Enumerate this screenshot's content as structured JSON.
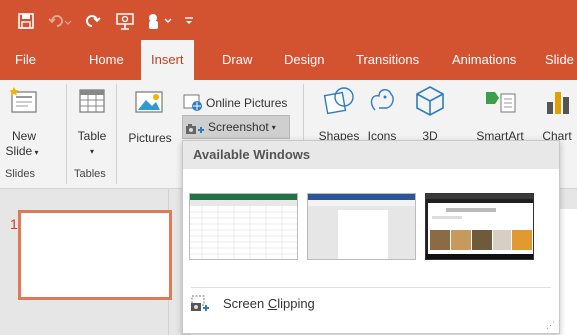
{
  "qat": {
    "save_icon": "save-icon",
    "undo_icon": "undo-icon",
    "redo_icon": "redo-icon",
    "from_beginning_icon": "presentation-icon",
    "touch_icon": "touch-mode-icon"
  },
  "tabs": [
    {
      "label": "File"
    },
    {
      "label": "Home"
    },
    {
      "label": "Insert",
      "active": true
    },
    {
      "label": "Draw"
    },
    {
      "label": "Design"
    },
    {
      "label": "Transitions"
    },
    {
      "label": "Animations"
    },
    {
      "label": "Slide"
    }
  ],
  "ribbon": {
    "slides": {
      "new_slide_l1": "New",
      "new_slide_l2": "Slide",
      "group": "Slides"
    },
    "tables": {
      "table": "Table",
      "group": "Tables"
    },
    "images": {
      "pictures": "Pictures",
      "online_pictures": "Online Pictures",
      "screenshot": "Screenshot"
    },
    "illustrations": {
      "shapes": "Shapes",
      "icons": "Icons",
      "threed": "3D",
      "smartart": "SmartArt",
      "chart": "Chart"
    }
  },
  "slide_panel": {
    "number": "1"
  },
  "dropdown": {
    "header": "Available Windows",
    "windows": [
      {
        "name": "Excel window"
      },
      {
        "name": "Word window"
      },
      {
        "name": "Browser window"
      }
    ],
    "clip_label_prefix": "Screen ",
    "clip_label_underlined": "C",
    "clip_label_rest": "lipping"
  },
  "colors": {
    "accent": "#d35230",
    "active_tab_text": "#c43e1c"
  }
}
